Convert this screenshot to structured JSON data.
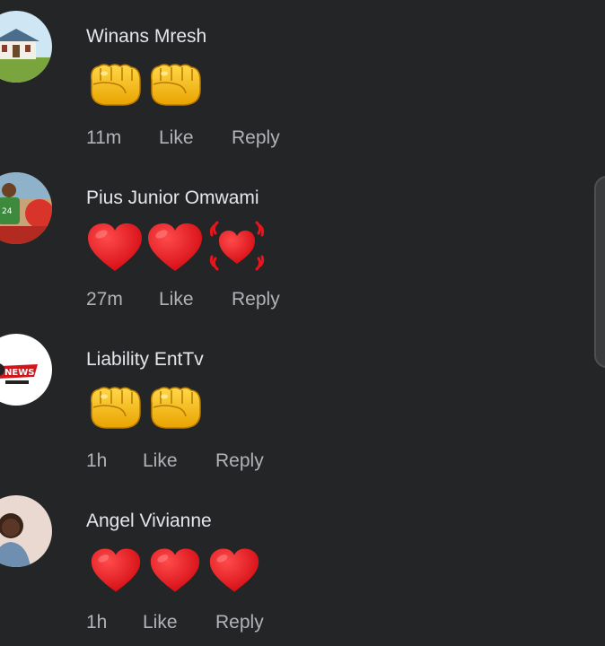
{
  "comments": [
    {
      "author": "Winans Mresh",
      "reaction": "fist-emoji fist-emoji",
      "time": "11m",
      "like_label": "Like",
      "reply_label": "Reply"
    },
    {
      "author": "Pius Junior Omwami",
      "reaction": "heart-emoji heart-emoji beating-heart-emoji",
      "time": "27m",
      "like_label": "Like",
      "reply_label": "Reply"
    },
    {
      "author": "Liability EntTv",
      "reaction": "fist-emoji fist-emoji",
      "time": "1h",
      "like_label": "Like",
      "reply_label": "Reply"
    },
    {
      "author": "Angel Vivianne",
      "reaction": "heart-emoji heart-emoji heart-emoji",
      "time": "1h",
      "like_label": "Like",
      "reply_label": "Reply"
    }
  ],
  "avatar_badge_text": "NEWS",
  "colors": {
    "background": "#242526",
    "text_primary": "#e4e6eb",
    "text_secondary": "#b0b3b8",
    "heart": "#e8141c",
    "fist": "#f4b400"
  }
}
